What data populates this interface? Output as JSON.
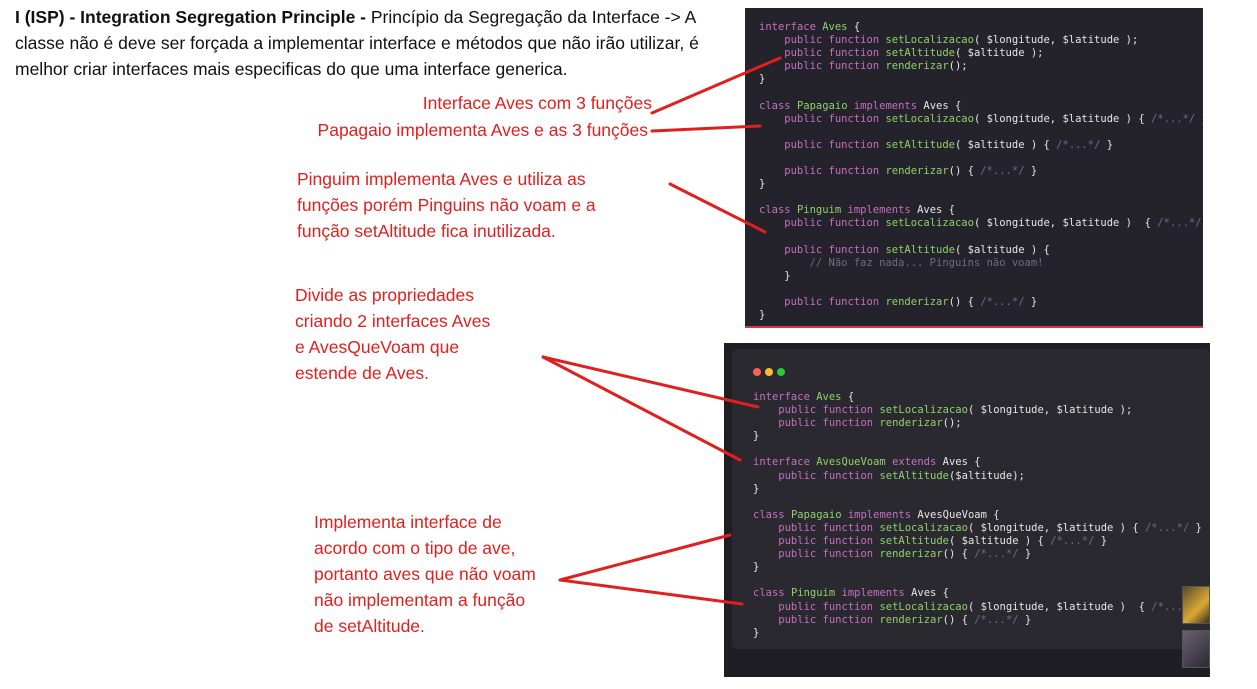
{
  "intro": {
    "bold": "I (ISP) - Integration Segregation Principle -",
    "text": " Princípio da Segregação da Interface -> A classe não é deve ser forçada a implementar interface e métodos que não irão utilizar, é melhor criar interfaces mais especificas do que uma interface generica."
  },
  "notes": {
    "n1": "Interface Aves com 3 funções",
    "n2": "Papagaio implementa Aves e as 3 funções",
    "n3": "Pinguim implementa Aves e utiliza as\nfunções porém Pinguins não voam e a\nfunção setAltitude fica inutilizada.",
    "n4": "Divide as propriedades\ncriando 2 interfaces Aves\ne AvesQueVoam que\nestende de Aves.",
    "n5": "Implementa interface de\nacordo com o tipo de ave,\nportanto aves que não voam\nnão implementam a função\nde setAltitude."
  },
  "colors": {
    "annotation_red": "#e0201e",
    "code_bg": "#24222a",
    "keyword": "#c46fc0",
    "function": "#8fd16a",
    "comment": "#6f6b8a",
    "dot_red": "#ff5f57",
    "dot_yellow": "#febc2e",
    "dot_green": "#28c840"
  },
  "code1": [
    [
      [
        "kw",
        "interface "
      ],
      [
        "cls",
        "Aves"
      ],
      [
        "punc",
        " {"
      ]
    ],
    [
      [
        "kw",
        "    public function "
      ],
      [
        "fn",
        "setLocalizacao"
      ],
      [
        "punc",
        "( $longitude, $latitude );"
      ]
    ],
    [
      [
        "kw",
        "    public function "
      ],
      [
        "fn",
        "setAltitude"
      ],
      [
        "punc",
        "( $altitude );"
      ]
    ],
    [
      [
        "kw",
        "    public function "
      ],
      [
        "fn",
        "renderizar"
      ],
      [
        "punc",
        "();"
      ]
    ],
    [
      [
        "punc",
        "}"
      ]
    ],
    [
      [
        "punc",
        ""
      ]
    ],
    [
      [
        "kw",
        "class "
      ],
      [
        "cls",
        "Papagaio "
      ],
      [
        "kw",
        "implements "
      ],
      [
        "punc",
        "Aves {"
      ]
    ],
    [
      [
        "kw",
        "    public function "
      ],
      [
        "fn",
        "setLocalizacao"
      ],
      [
        "punc",
        "( $longitude, $latitude ) { "
      ],
      [
        "cm",
        "/*...*/"
      ],
      [
        "punc",
        " }"
      ]
    ],
    [
      [
        "punc",
        ""
      ]
    ],
    [
      [
        "kw",
        "    public function "
      ],
      [
        "fn",
        "setAltitude"
      ],
      [
        "punc",
        "( $altitude ) { "
      ],
      [
        "cm",
        "/*...*/"
      ],
      [
        "punc",
        " }"
      ]
    ],
    [
      [
        "punc",
        ""
      ]
    ],
    [
      [
        "kw",
        "    public function "
      ],
      [
        "fn",
        "renderizar"
      ],
      [
        "punc",
        "() { "
      ],
      [
        "cm",
        "/*...*/"
      ],
      [
        "punc",
        " }"
      ]
    ],
    [
      [
        "punc",
        "}"
      ]
    ],
    [
      [
        "punc",
        ""
      ]
    ],
    [
      [
        "kw",
        "class "
      ],
      [
        "cls",
        "Pinguim "
      ],
      [
        "kw",
        "implements "
      ],
      [
        "punc",
        "Aves {"
      ]
    ],
    [
      [
        "kw",
        "    public function "
      ],
      [
        "fn",
        "setLocalizacao"
      ],
      [
        "punc",
        "( $longitude, $latitude )  { "
      ],
      [
        "cm",
        "/*...*/"
      ],
      [
        "punc",
        " }"
      ]
    ],
    [
      [
        "punc",
        ""
      ]
    ],
    [
      [
        "kw",
        "    public function "
      ],
      [
        "fn",
        "setAltitude"
      ],
      [
        "punc",
        "( $altitude ) {"
      ]
    ],
    [
      [
        "cm",
        "        // Não faz nada... Pinguins não voam!"
      ]
    ],
    [
      [
        "punc",
        "    }"
      ]
    ],
    [
      [
        "punc",
        ""
      ]
    ],
    [
      [
        "kw",
        "    public function "
      ],
      [
        "fn",
        "renderizar"
      ],
      [
        "punc",
        "() { "
      ],
      [
        "cm",
        "/*...*/"
      ],
      [
        "punc",
        " }"
      ]
    ],
    [
      [
        "punc",
        "}"
      ]
    ]
  ],
  "code2": [
    [
      [
        "kw",
        "interface "
      ],
      [
        "cls",
        "Aves"
      ],
      [
        "punc",
        " {"
      ]
    ],
    [
      [
        "kw",
        "    public function "
      ],
      [
        "fn",
        "setLocalizacao"
      ],
      [
        "punc",
        "( $longitude, $latitude );"
      ]
    ],
    [
      [
        "kw",
        "    public function "
      ],
      [
        "fn",
        "renderizar"
      ],
      [
        "punc",
        "();"
      ]
    ],
    [
      [
        "punc",
        "}"
      ]
    ],
    [
      [
        "punc",
        ""
      ]
    ],
    [
      [
        "kw",
        "interface "
      ],
      [
        "cls",
        "AvesQueVoam "
      ],
      [
        "kw",
        "extends "
      ],
      [
        "punc",
        "Aves {"
      ]
    ],
    [
      [
        "kw",
        "    public function "
      ],
      [
        "fn",
        "setAltitude"
      ],
      [
        "punc",
        "($altitude);"
      ]
    ],
    [
      [
        "punc",
        "}"
      ]
    ],
    [
      [
        "punc",
        ""
      ]
    ],
    [
      [
        "kw",
        "class "
      ],
      [
        "cls",
        "Papagaio "
      ],
      [
        "kw",
        "implements "
      ],
      [
        "punc",
        "AvesQueVoam {"
      ]
    ],
    [
      [
        "kw",
        "    public function "
      ],
      [
        "fn",
        "setLocalizacao"
      ],
      [
        "punc",
        "( $longitude, $latitude ) { "
      ],
      [
        "cm",
        "/*...*/"
      ],
      [
        "punc",
        " }"
      ]
    ],
    [
      [
        "kw",
        "    public function "
      ],
      [
        "fn",
        "setAltitude"
      ],
      [
        "punc",
        "( $altitude ) { "
      ],
      [
        "cm",
        "/*...*/"
      ],
      [
        "punc",
        " }"
      ]
    ],
    [
      [
        "kw",
        "    public function "
      ],
      [
        "fn",
        "renderizar"
      ],
      [
        "punc",
        "() { "
      ],
      [
        "cm",
        "/*...*/"
      ],
      [
        "punc",
        " }"
      ]
    ],
    [
      [
        "punc",
        "}"
      ]
    ],
    [
      [
        "punc",
        ""
      ]
    ],
    [
      [
        "kw",
        "class "
      ],
      [
        "cls",
        "Pinguim "
      ],
      [
        "kw",
        "implements "
      ],
      [
        "punc",
        "Aves {"
      ]
    ],
    [
      [
        "kw",
        "    public function "
      ],
      [
        "fn",
        "setLocalizacao"
      ],
      [
        "punc",
        "( $longitude, $latitude )  { "
      ],
      [
        "cm",
        "/*...*/"
      ],
      [
        "punc",
        " }"
      ]
    ],
    [
      [
        "kw",
        "    public function "
      ],
      [
        "fn",
        "renderizar"
      ],
      [
        "punc",
        "() { "
      ],
      [
        "cm",
        "/*...*/"
      ],
      [
        "punc",
        " }"
      ]
    ],
    [
      [
        "punc",
        "}"
      ]
    ]
  ]
}
